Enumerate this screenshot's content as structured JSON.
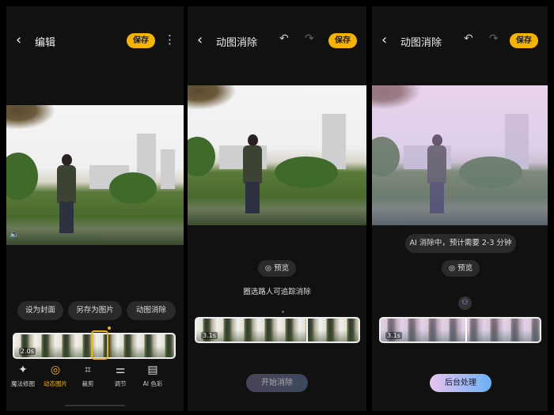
{
  "panel1": {
    "back_icon": "chevron-left",
    "title": "编辑",
    "save": "保存",
    "more_icon": "more-vertical",
    "actions": [
      "设为封面",
      "另存为图片",
      "动图消除"
    ],
    "duration": "2.0s",
    "tools": [
      {
        "icon": "magic-retouch",
        "label": "魔法修图"
      },
      {
        "icon": "live-photo",
        "label": "动态图片",
        "active": true
      },
      {
        "icon": "crop",
        "label": "裁剪"
      },
      {
        "icon": "adjust",
        "label": "调节"
      },
      {
        "icon": "ai-color",
        "label": "AI 色彩"
      }
    ]
  },
  "panel2": {
    "title": "动图消除",
    "save": "保存",
    "preview": "预览",
    "hint": "圈选路人可追踪消除",
    "duration": "3.1s",
    "start": "开始消除"
  },
  "panel3": {
    "title": "动图消除",
    "save": "保存",
    "status": "AI 消除中，预计需要 2-3 分钟",
    "preview": "预览",
    "duration": "3.1s",
    "background": "后台处理"
  },
  "colors": {
    "accent": "#f5b400"
  }
}
